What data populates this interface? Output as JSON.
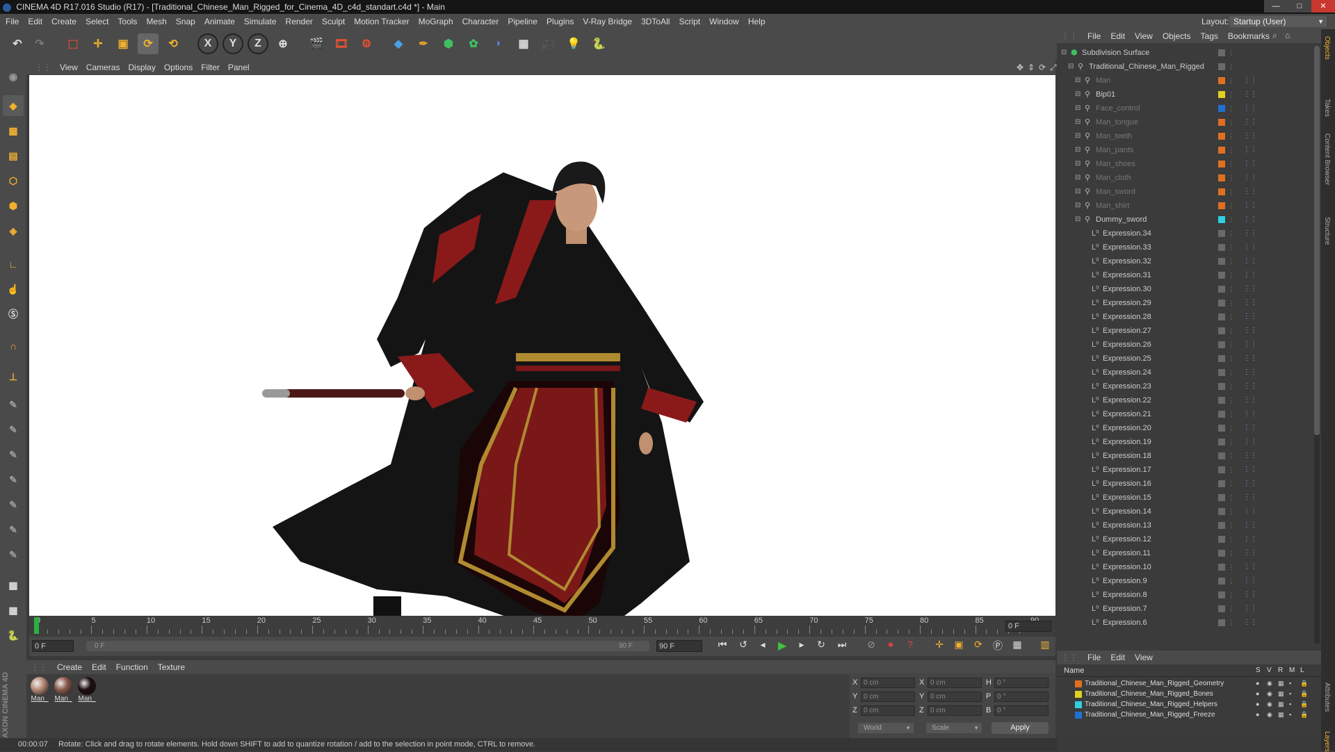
{
  "window": {
    "title": "CINEMA 4D R17.016 Studio (R17) - [Traditional_Chinese_Man_Rigged_for_Cinema_4D_c4d_standart.c4d *] - Main"
  },
  "menu": [
    "File",
    "Edit",
    "Create",
    "Select",
    "Tools",
    "Mesh",
    "Snap",
    "Animate",
    "Simulate",
    "Render",
    "Sculpt",
    "Motion Tracker",
    "MoGraph",
    "Character",
    "Pipeline",
    "Plugins",
    "V-Ray Bridge",
    "3DToAll",
    "Script",
    "Window",
    "Help"
  ],
  "layout": {
    "label": "Layout:",
    "value": "Startup (User)"
  },
  "toolbar": {
    "x": "X",
    "y": "Y",
    "z": "Z"
  },
  "viewport_menu": [
    "View",
    "Cameras",
    "Display",
    "Options",
    "Filter",
    "Panel"
  ],
  "timeline": {
    "ticks": [
      "0",
      "5",
      "10",
      "15",
      "20",
      "25",
      "30",
      "35",
      "40",
      "45",
      "50",
      "55",
      "60",
      "65",
      "70",
      "75",
      "80",
      "85",
      "90"
    ],
    "current_frame": "0 F",
    "start_field": "0 F",
    "range_start": "0 F",
    "range_end": "90 F",
    "end_field": "90 F",
    "progress": 0.0
  },
  "material_panel": {
    "menu": [
      "Create",
      "Edit",
      "Function",
      "Texture"
    ],
    "materials": [
      {
        "label": "Man_",
        "color": "#b88a76"
      },
      {
        "label": "Man_",
        "color": "#8a5a4a"
      },
      {
        "label": "Man_",
        "color": "#1e0d0d"
      }
    ]
  },
  "coords": {
    "rows": [
      {
        "a": "X",
        "av": "0 cm",
        "b": "X",
        "bv": "0 cm",
        "c": "H",
        "cv": "0 °"
      },
      {
        "a": "Y",
        "av": "0 cm",
        "b": "Y",
        "bv": "0 cm",
        "c": "P",
        "cv": "0 °"
      },
      {
        "a": "Z",
        "av": "0 cm",
        "b": "Z",
        "bv": "0 cm",
        "c": "B",
        "cv": "0 °"
      }
    ],
    "space": "World",
    "mode": "Scale",
    "apply": "Apply"
  },
  "status": {
    "time": "00:00:07",
    "message": "Rotate: Click and drag to rotate elements. Hold down SHIFT to add to quantize rotation / add to the selection in point mode, CTRL to remove."
  },
  "objects": {
    "menu": [
      "File",
      "Edit",
      "View",
      "Objects",
      "Tags",
      "Bookmarks"
    ],
    "items": [
      {
        "name": "Subdivision Surface",
        "indent": 0,
        "dim": false,
        "color": "#6a6a6a"
      },
      {
        "name": "Traditional_Chinese_Man_Rigged",
        "indent": 1,
        "dim": false,
        "color": "#6a6a6a"
      },
      {
        "name": "Man",
        "indent": 2,
        "dim": true,
        "color": "#e07020"
      },
      {
        "name": "Bip01",
        "indent": 2,
        "dim": false,
        "color": "#e0d020"
      },
      {
        "name": "Face_control",
        "indent": 2,
        "dim": true,
        "color": "#2070d0"
      },
      {
        "name": "Man_tongue",
        "indent": 2,
        "dim": true,
        "color": "#e07020"
      },
      {
        "name": "Man_teeth",
        "indent": 2,
        "dim": true,
        "color": "#e07020"
      },
      {
        "name": "Man_pants",
        "indent": 2,
        "dim": true,
        "color": "#e07020"
      },
      {
        "name": "Man_shoes",
        "indent": 2,
        "dim": true,
        "color": "#e07020"
      },
      {
        "name": "Man_cloth",
        "indent": 2,
        "dim": true,
        "color": "#e07020"
      },
      {
        "name": "Man_sword",
        "indent": 2,
        "dim": true,
        "color": "#e07020"
      },
      {
        "name": "Man_shirt",
        "indent": 2,
        "dim": true,
        "color": "#e07020"
      },
      {
        "name": "Dummy_sword",
        "indent": 2,
        "dim": false,
        "color": "#30d0e0"
      },
      {
        "name": "Expression.34",
        "indent": 3,
        "dim": false,
        "color": "#6a6a6a"
      },
      {
        "name": "Expression.33",
        "indent": 3,
        "dim": false,
        "color": "#6a6a6a"
      },
      {
        "name": "Expression.32",
        "indent": 3,
        "dim": false,
        "color": "#6a6a6a"
      },
      {
        "name": "Expression.31",
        "indent": 3,
        "dim": false,
        "color": "#6a6a6a"
      },
      {
        "name": "Expression.30",
        "indent": 3,
        "dim": false,
        "color": "#6a6a6a"
      },
      {
        "name": "Expression.29",
        "indent": 3,
        "dim": false,
        "color": "#6a6a6a"
      },
      {
        "name": "Expression.28",
        "indent": 3,
        "dim": false,
        "color": "#6a6a6a"
      },
      {
        "name": "Expression.27",
        "indent": 3,
        "dim": false,
        "color": "#6a6a6a"
      },
      {
        "name": "Expression.26",
        "indent": 3,
        "dim": false,
        "color": "#6a6a6a"
      },
      {
        "name": "Expression.25",
        "indent": 3,
        "dim": false,
        "color": "#6a6a6a"
      },
      {
        "name": "Expression.24",
        "indent": 3,
        "dim": false,
        "color": "#6a6a6a"
      },
      {
        "name": "Expression.23",
        "indent": 3,
        "dim": false,
        "color": "#6a6a6a"
      },
      {
        "name": "Expression.22",
        "indent": 3,
        "dim": false,
        "color": "#6a6a6a"
      },
      {
        "name": "Expression.21",
        "indent": 3,
        "dim": false,
        "color": "#6a6a6a"
      },
      {
        "name": "Expression.20",
        "indent": 3,
        "dim": false,
        "color": "#6a6a6a"
      },
      {
        "name": "Expression.19",
        "indent": 3,
        "dim": false,
        "color": "#6a6a6a"
      },
      {
        "name": "Expression.18",
        "indent": 3,
        "dim": false,
        "color": "#6a6a6a"
      },
      {
        "name": "Expression.17",
        "indent": 3,
        "dim": false,
        "color": "#6a6a6a"
      },
      {
        "name": "Expression.16",
        "indent": 3,
        "dim": false,
        "color": "#6a6a6a"
      },
      {
        "name": "Expression.15",
        "indent": 3,
        "dim": false,
        "color": "#6a6a6a"
      },
      {
        "name": "Expression.14",
        "indent": 3,
        "dim": false,
        "color": "#6a6a6a"
      },
      {
        "name": "Expression.13",
        "indent": 3,
        "dim": false,
        "color": "#6a6a6a"
      },
      {
        "name": "Expression.12",
        "indent": 3,
        "dim": false,
        "color": "#6a6a6a"
      },
      {
        "name": "Expression.11",
        "indent": 3,
        "dim": false,
        "color": "#6a6a6a"
      },
      {
        "name": "Expression.10",
        "indent": 3,
        "dim": false,
        "color": "#6a6a6a"
      },
      {
        "name": "Expression.9",
        "indent": 3,
        "dim": false,
        "color": "#6a6a6a"
      },
      {
        "name": "Expression.8",
        "indent": 3,
        "dim": false,
        "color": "#6a6a6a"
      },
      {
        "name": "Expression.7",
        "indent": 3,
        "dim": false,
        "color": "#6a6a6a"
      },
      {
        "name": "Expression.6",
        "indent": 3,
        "dim": false,
        "color": "#6a6a6a"
      }
    ]
  },
  "layers": {
    "menu": [
      "File",
      "Edit",
      "View"
    ],
    "header": {
      "name": "Name",
      "cols": [
        "S",
        "V",
        "R",
        "M",
        "L"
      ]
    },
    "items": [
      {
        "name": "Traditional_Chinese_Man_Rigged_Geometry",
        "color": "#e07020"
      },
      {
        "name": "Traditional_Chinese_Man_Rigged_Bones",
        "color": "#e0d020"
      },
      {
        "name": "Traditional_Chinese_Man_Rigged_Helpers",
        "color": "#30d0e0"
      },
      {
        "name": "Traditional_Chinese_Man_Rigged_Freeze",
        "color": "#2070d0"
      }
    ]
  },
  "side_tabs": [
    "Objects",
    "Takes",
    "Content Browser",
    "Structure",
    "Attributes",
    "Layers"
  ]
}
